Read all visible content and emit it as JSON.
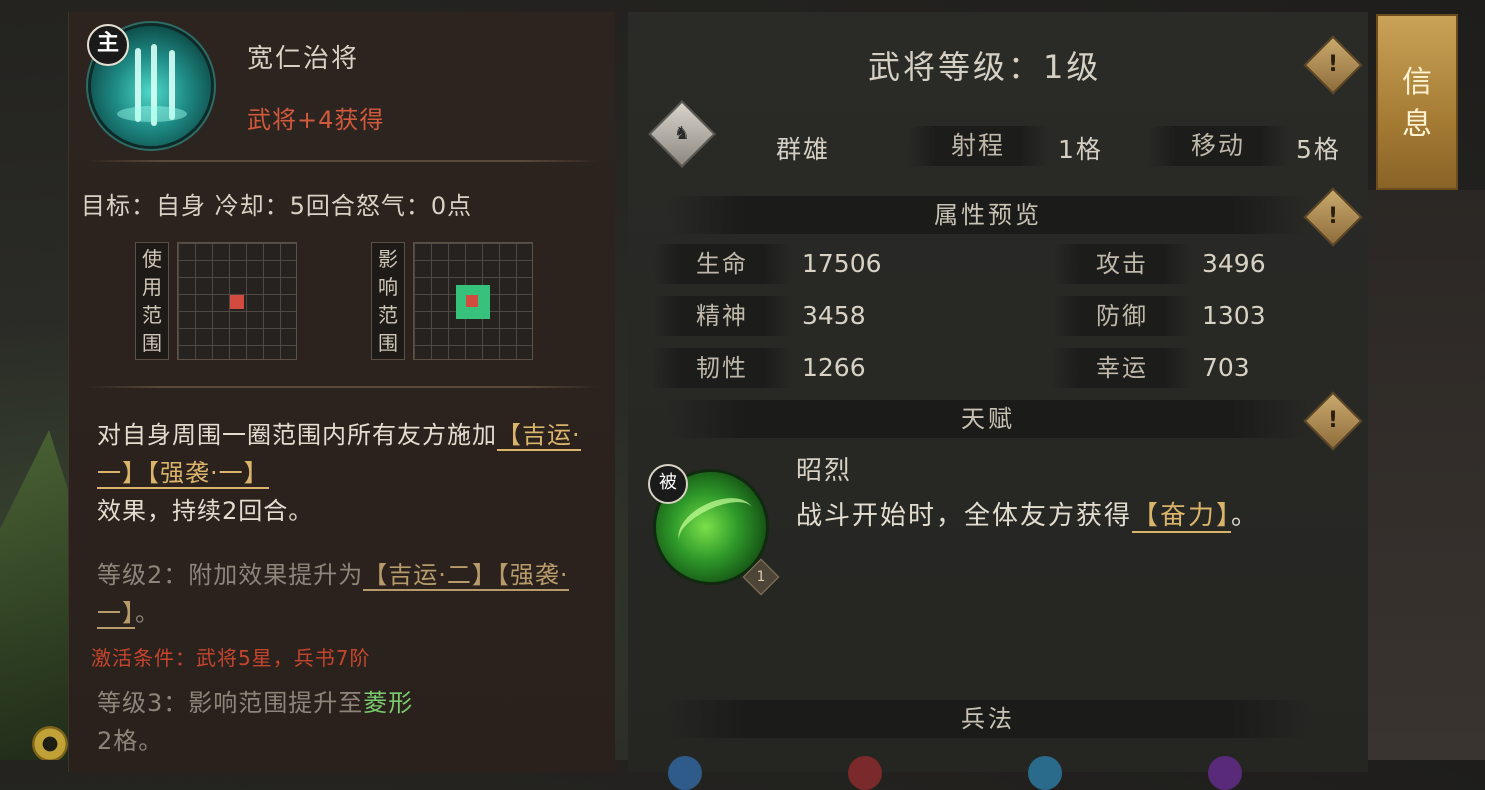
{
  "skill": {
    "badge": "主",
    "name": "宽仁治将",
    "bonus": "武将+4获得",
    "stats": "目标：自身  冷却：5回合怒气：0点",
    "use_range_label": "使用范围",
    "effect_range_label": "影响范围",
    "desc_main_pre": "对自身周围一圈范围内所有友方施加",
    "desc_tag1": "【吉运·一】",
    "desc_tag2": "【强袭·一】",
    "desc_main_post": "效果，持续2回合。",
    "lv2_pre": "等级2：附加效果提升为",
    "lv2_tag1": "【吉运·二】",
    "lv2_tag2": "【强袭·一】",
    "lv2_post": "。",
    "activate": "激活条件：武将5星，兵书7阶",
    "lv3_pre": "等级3：影响范围提升至",
    "lv3_green": "菱形",
    "lv3_post": "2格。"
  },
  "general": {
    "level_title": "武将等级：1级",
    "faction": "群雄",
    "range_label": "射程",
    "range_value": "1格",
    "move_label": "移动",
    "move_value": "5格",
    "attr_section": "属性预览",
    "attributes": [
      {
        "label": "生命",
        "value": "17506"
      },
      {
        "label": "攻击",
        "value": "3496"
      },
      {
        "label": "精神",
        "value": "3458"
      },
      {
        "label": "防御",
        "value": "1303"
      },
      {
        "label": "韧性",
        "value": "1266"
      },
      {
        "label": "幸运",
        "value": "703"
      }
    ],
    "talent_section": "天赋",
    "talent_badge": "被",
    "talent_level": "1",
    "talent_name": "昭烈",
    "talent_desc_pre": "战斗开始时，全体友方获得",
    "talent_tag": "【奋力】",
    "talent_desc_post": "。",
    "tactics_section": "兵法",
    "hint_icon": "!"
  },
  "tab": {
    "label": "信息"
  },
  "colors": {
    "gold": "#d9b46a",
    "red": "#d25a3c",
    "green": "#7acb6f"
  }
}
